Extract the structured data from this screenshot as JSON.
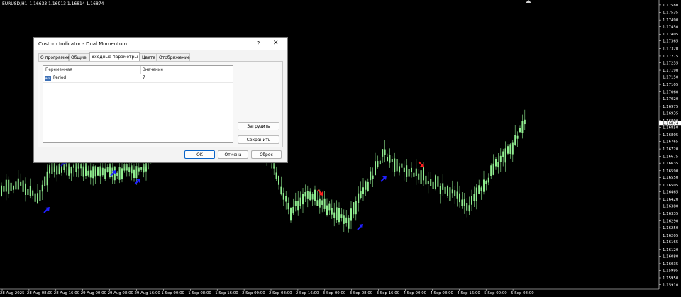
{
  "chart": {
    "symbol_label": "EURUSD,H1",
    "ohlc": "1.16633 1.16913 1.16814 1.16874",
    "current_price": "1.16874",
    "price_axis": {
      "min": 1.15895,
      "max": 1.17588,
      "labels": [
        "1.17580",
        "1.17535",
        "1.17490",
        "1.17450",
        "1.17405",
        "1.17365",
        "1.17320",
        "1.17275",
        "1.17235",
        "1.17190",
        "1.17150",
        "1.17105",
        "1.17060",
        "1.17020",
        "1.16975",
        "1.16935",
        "1.16890",
        "1.16850",
        "1.16805",
        "1.16765",
        "1.16720",
        "1.16675",
        "1.16635",
        "1.16590",
        "1.16550",
        "1.16505",
        "1.16465",
        "1.16420",
        "1.16380",
        "1.16335",
        "1.16290",
        "1.16250",
        "1.16205",
        "1.16165",
        "1.16120",
        "1.16080",
        "1.16035",
        "1.15995",
        "1.15950",
        "1.15910"
      ]
    },
    "time_axis": [
      "28 Aug 2025",
      "28 Aug 08:00",
      "28 Aug 16:00",
      "29 Aug 00:00",
      "29 Aug 08:00",
      "29 Aug 16:00",
      "1 Sep 00:00",
      "1 Sep 08:00",
      "1 Sep 16:00",
      "2 Sep 00:00",
      "2 Sep 08:00",
      "2 Sep 16:00",
      "3 Sep 00:00",
      "3 Sep 08:00",
      "3 Sep 16:00",
      "4 Sep 00:00",
      "4 Sep 08:00",
      "4 Sep 16:00",
      "5 Sep 00:00",
      "5 Sep 08:00"
    ],
    "colors": {
      "background": "#000000",
      "candle": "#90ee90",
      "up_arrow": "#2020ff",
      "down_arrow": "#ff2020",
      "axis_text": "#ffffff",
      "price_line": "#5a5a5a"
    }
  },
  "dialog": {
    "title": "Custom Indicator - Dual Momentum",
    "help_glyph": "?",
    "close_glyph": "✕",
    "tabs": [
      {
        "label": "О программе"
      },
      {
        "label": "Общие"
      },
      {
        "label": "Входные параметры"
      },
      {
        "label": "Цвета"
      },
      {
        "label": "Отображение"
      }
    ],
    "table": {
      "col_variable": "Переменная",
      "col_value": "Значение",
      "rows": [
        {
          "type_badge": "123",
          "name": "Period",
          "value": "7"
        }
      ]
    },
    "load_button": "Загрузить",
    "save_button": "Сохранить",
    "ok_button": "OK",
    "cancel_button": "Отмена",
    "reset_button": "Сброс"
  }
}
